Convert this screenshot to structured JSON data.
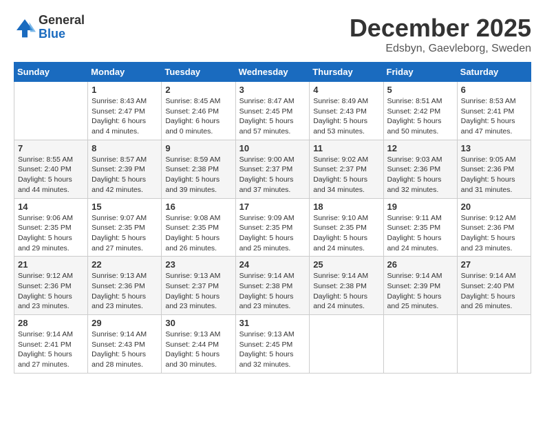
{
  "logo": {
    "general": "General",
    "blue": "Blue"
  },
  "title": {
    "month": "December 2025",
    "location": "Edsbyn, Gaevleborg, Sweden"
  },
  "calendar": {
    "headers": [
      "Sunday",
      "Monday",
      "Tuesday",
      "Wednesday",
      "Thursday",
      "Friday",
      "Saturday"
    ],
    "weeks": [
      [
        {
          "day": "",
          "info": ""
        },
        {
          "day": "1",
          "info": "Sunrise: 8:43 AM\nSunset: 2:47 PM\nDaylight: 6 hours\nand 4 minutes."
        },
        {
          "day": "2",
          "info": "Sunrise: 8:45 AM\nSunset: 2:46 PM\nDaylight: 6 hours\nand 0 minutes."
        },
        {
          "day": "3",
          "info": "Sunrise: 8:47 AM\nSunset: 2:45 PM\nDaylight: 5 hours\nand 57 minutes."
        },
        {
          "day": "4",
          "info": "Sunrise: 8:49 AM\nSunset: 2:43 PM\nDaylight: 5 hours\nand 53 minutes."
        },
        {
          "day": "5",
          "info": "Sunrise: 8:51 AM\nSunset: 2:42 PM\nDaylight: 5 hours\nand 50 minutes."
        },
        {
          "day": "6",
          "info": "Sunrise: 8:53 AM\nSunset: 2:41 PM\nDaylight: 5 hours\nand 47 minutes."
        }
      ],
      [
        {
          "day": "7",
          "info": "Sunrise: 8:55 AM\nSunset: 2:40 PM\nDaylight: 5 hours\nand 44 minutes."
        },
        {
          "day": "8",
          "info": "Sunrise: 8:57 AM\nSunset: 2:39 PM\nDaylight: 5 hours\nand 42 minutes."
        },
        {
          "day": "9",
          "info": "Sunrise: 8:59 AM\nSunset: 2:38 PM\nDaylight: 5 hours\nand 39 minutes."
        },
        {
          "day": "10",
          "info": "Sunrise: 9:00 AM\nSunset: 2:37 PM\nDaylight: 5 hours\nand 37 minutes."
        },
        {
          "day": "11",
          "info": "Sunrise: 9:02 AM\nSunset: 2:37 PM\nDaylight: 5 hours\nand 34 minutes."
        },
        {
          "day": "12",
          "info": "Sunrise: 9:03 AM\nSunset: 2:36 PM\nDaylight: 5 hours\nand 32 minutes."
        },
        {
          "day": "13",
          "info": "Sunrise: 9:05 AM\nSunset: 2:36 PM\nDaylight: 5 hours\nand 31 minutes."
        }
      ],
      [
        {
          "day": "14",
          "info": "Sunrise: 9:06 AM\nSunset: 2:35 PM\nDaylight: 5 hours\nand 29 minutes."
        },
        {
          "day": "15",
          "info": "Sunrise: 9:07 AM\nSunset: 2:35 PM\nDaylight: 5 hours\nand 27 minutes."
        },
        {
          "day": "16",
          "info": "Sunrise: 9:08 AM\nSunset: 2:35 PM\nDaylight: 5 hours\nand 26 minutes."
        },
        {
          "day": "17",
          "info": "Sunrise: 9:09 AM\nSunset: 2:35 PM\nDaylight: 5 hours\nand 25 minutes."
        },
        {
          "day": "18",
          "info": "Sunrise: 9:10 AM\nSunset: 2:35 PM\nDaylight: 5 hours\nand 24 minutes."
        },
        {
          "day": "19",
          "info": "Sunrise: 9:11 AM\nSunset: 2:35 PM\nDaylight: 5 hours\nand 24 minutes."
        },
        {
          "day": "20",
          "info": "Sunrise: 9:12 AM\nSunset: 2:36 PM\nDaylight: 5 hours\nand 23 minutes."
        }
      ],
      [
        {
          "day": "21",
          "info": "Sunrise: 9:12 AM\nSunset: 2:36 PM\nDaylight: 5 hours\nand 23 minutes."
        },
        {
          "day": "22",
          "info": "Sunrise: 9:13 AM\nSunset: 2:36 PM\nDaylight: 5 hours\nand 23 minutes."
        },
        {
          "day": "23",
          "info": "Sunrise: 9:13 AM\nSunset: 2:37 PM\nDaylight: 5 hours\nand 23 minutes."
        },
        {
          "day": "24",
          "info": "Sunrise: 9:14 AM\nSunset: 2:38 PM\nDaylight: 5 hours\nand 23 minutes."
        },
        {
          "day": "25",
          "info": "Sunrise: 9:14 AM\nSunset: 2:38 PM\nDaylight: 5 hours\nand 24 minutes."
        },
        {
          "day": "26",
          "info": "Sunrise: 9:14 AM\nSunset: 2:39 PM\nDaylight: 5 hours\nand 25 minutes."
        },
        {
          "day": "27",
          "info": "Sunrise: 9:14 AM\nSunset: 2:40 PM\nDaylight: 5 hours\nand 26 minutes."
        }
      ],
      [
        {
          "day": "28",
          "info": "Sunrise: 9:14 AM\nSunset: 2:41 PM\nDaylight: 5 hours\nand 27 minutes."
        },
        {
          "day": "29",
          "info": "Sunrise: 9:14 AM\nSunset: 2:43 PM\nDaylight: 5 hours\nand 28 minutes."
        },
        {
          "day": "30",
          "info": "Sunrise: 9:13 AM\nSunset: 2:44 PM\nDaylight: 5 hours\nand 30 minutes."
        },
        {
          "day": "31",
          "info": "Sunrise: 9:13 AM\nSunset: 2:45 PM\nDaylight: 5 hours\nand 32 minutes."
        },
        {
          "day": "",
          "info": ""
        },
        {
          "day": "",
          "info": ""
        },
        {
          "day": "",
          "info": ""
        }
      ]
    ]
  }
}
